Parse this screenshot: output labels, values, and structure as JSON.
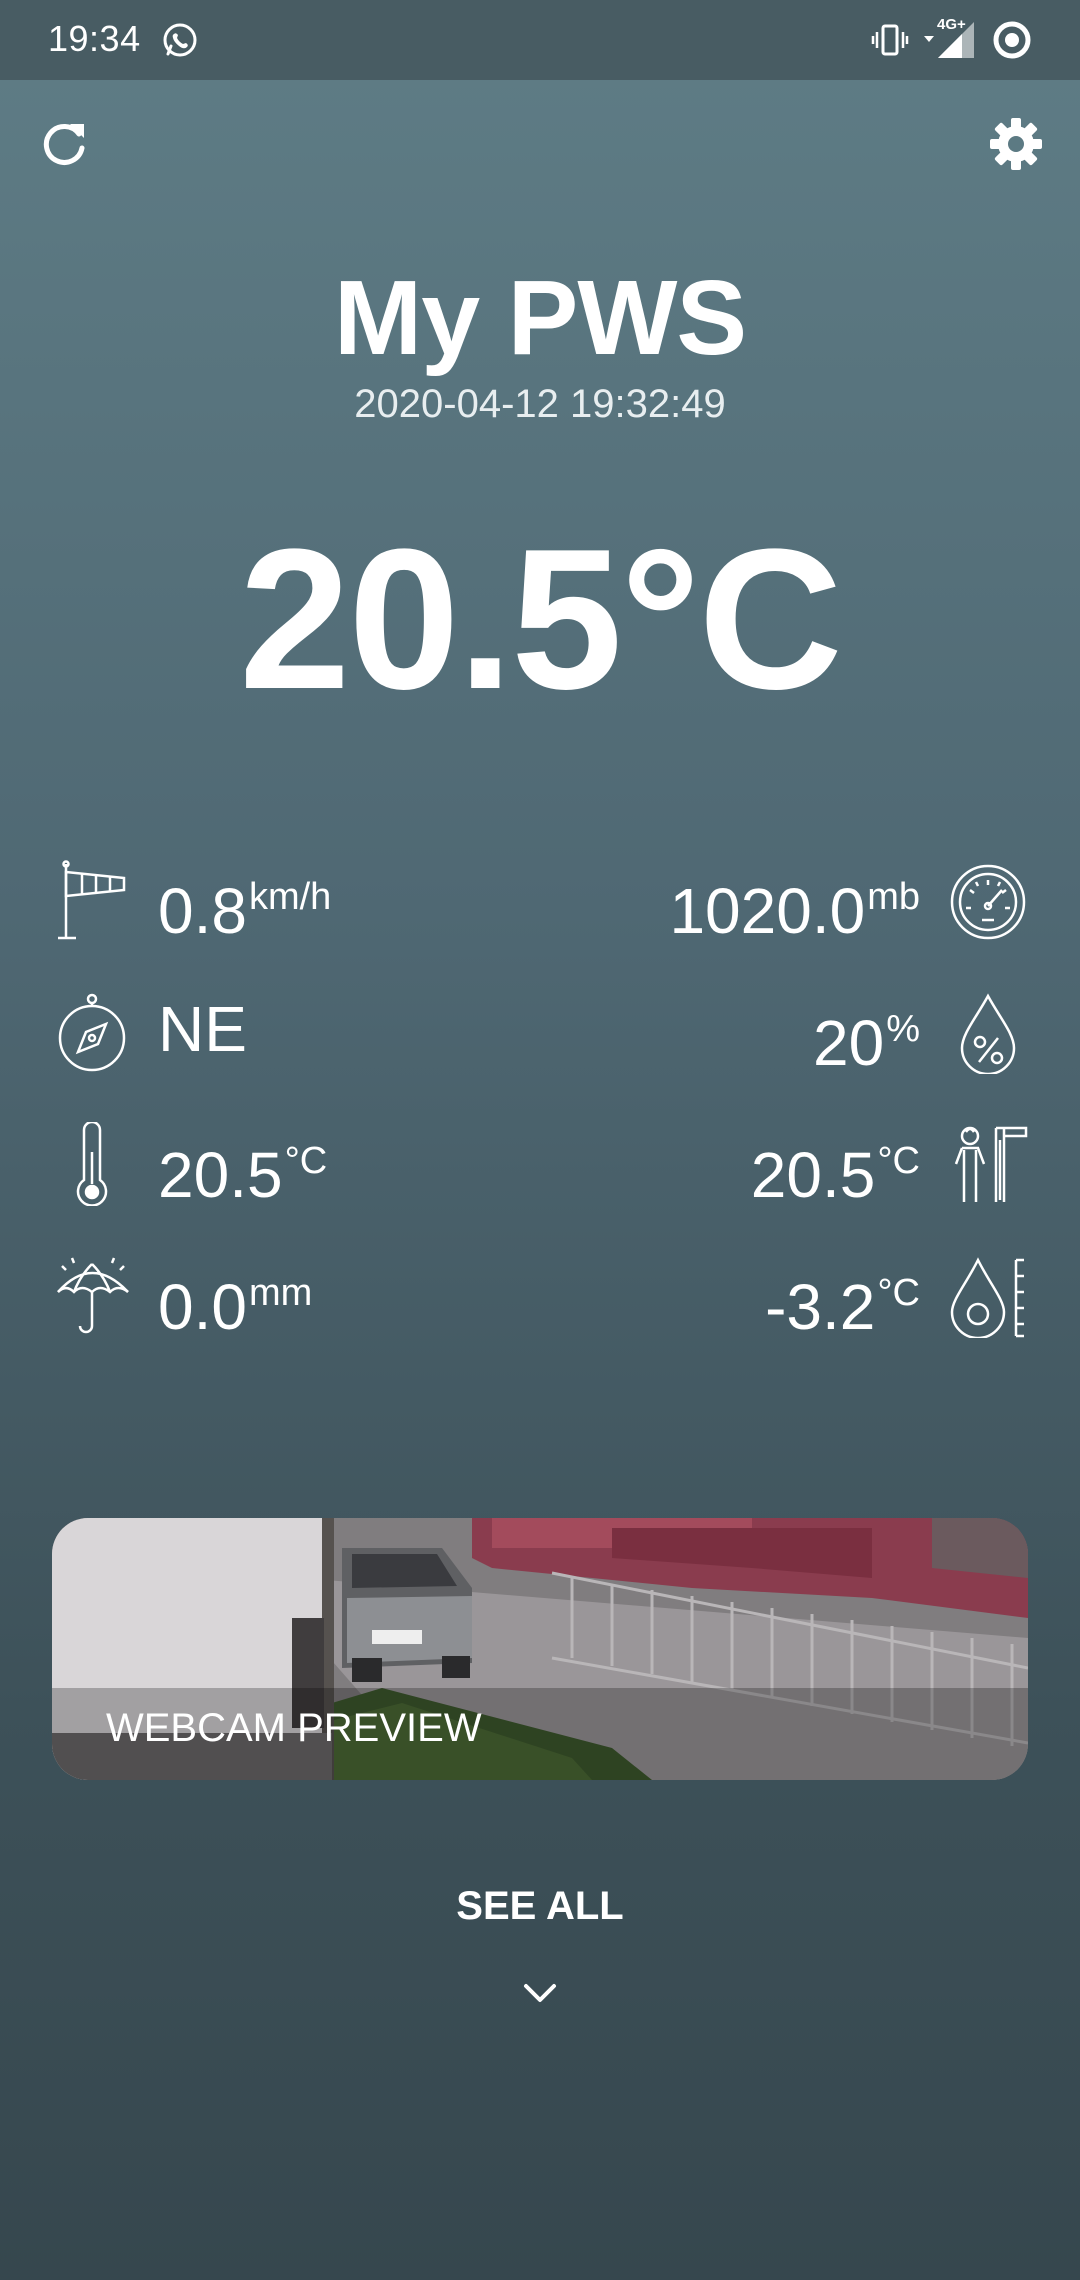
{
  "status_bar": {
    "time": "19:34",
    "network_label": "4G+",
    "icons": [
      "whatsapp-icon",
      "vibrate-icon",
      "signal-icon",
      "data-saver-icon"
    ]
  },
  "header": {
    "refresh_icon": "refresh-icon",
    "settings_icon": "gear-icon"
  },
  "station": {
    "name": "My PWS",
    "timestamp": "2020-04-12 19:32:49",
    "temperature": "20.5°C"
  },
  "metrics": {
    "wind_speed": {
      "value": "0.8",
      "unit": "km/h",
      "icon": "windsock-icon"
    },
    "pressure": {
      "value": "1020.0",
      "unit": "mb",
      "icon": "barometer-icon"
    },
    "wind_direction": {
      "value": "NE",
      "unit": "",
      "icon": "compass-icon"
    },
    "humidity": {
      "value": "20",
      "unit": "%",
      "icon": "humidity-drop-icon"
    },
    "indoor_temp": {
      "value": "20.5",
      "unit": "°C",
      "icon": "thermometer-icon"
    },
    "feels_like": {
      "value": "20.5",
      "unit": "°C",
      "icon": "person-heat-icon"
    },
    "rain": {
      "value": "0.0",
      "unit": "mm",
      "icon": "umbrella-icon"
    },
    "dew_point": {
      "value": "-3.2",
      "unit": "°C",
      "icon": "dew-point-icon"
    }
  },
  "webcam": {
    "label": "WEBCAM PREVIEW"
  },
  "footer": {
    "see_all": "SEE ALL",
    "chevron_icon": "chevron-down-icon"
  }
}
